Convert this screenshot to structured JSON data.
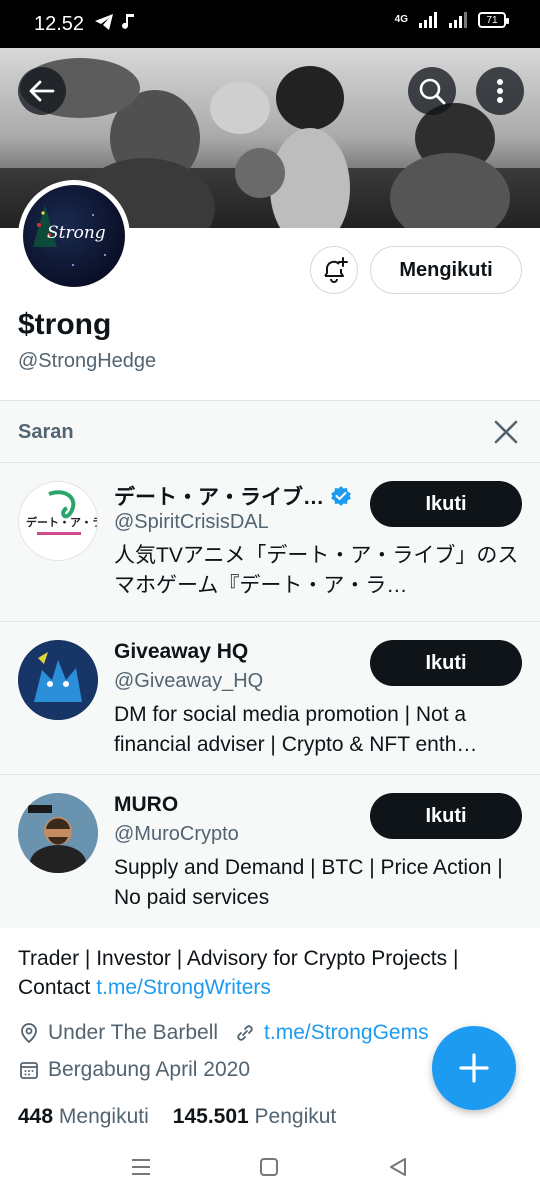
{
  "status_bar": {
    "time": "12.52",
    "network": "4G",
    "battery": "71"
  },
  "profile": {
    "display_name": "$trong",
    "handle": "@StrongHedge",
    "avatar_text": "Strong",
    "following_label": "Mengikuti",
    "bio_text": "Trader | Investor | Advisory for Crypto Projects | Contact ",
    "bio_link": "t.me/StrongWriters",
    "location": "Under The Barbell",
    "website": "t.me/StrongGems",
    "joined": "Bergabung April 2020",
    "following_count": "448",
    "following_text": "Mengikuti",
    "followers_count": "145.501",
    "followers_text": "Pengikut"
  },
  "suggestions": {
    "title": "Saran",
    "follow_label": "Ikuti",
    "items": [
      {
        "name": "デート・ア・ライブ…",
        "handle": "@SpiritCrisisDAL",
        "verified": true,
        "bio": "人気TVアニメ「デート・ア・ライブ」のスマホゲーム『デート・ア・ラ…",
        "avatar_text": "デート・ア・ライブ"
      },
      {
        "name": "Giveaway HQ",
        "handle": "@Giveaway_HQ",
        "verified": false,
        "bio": "DM for social media promotion | Not a financial adviser | Crypto & NFT enth…"
      },
      {
        "name": "MURO",
        "handle": "@MuroCrypto",
        "verified": false,
        "bio": "Supply and Demand | BTC | Price Action | No paid services"
      }
    ]
  },
  "colors": {
    "accent": "#1d9bf0",
    "text": "#0f1419",
    "muted": "#536471"
  }
}
